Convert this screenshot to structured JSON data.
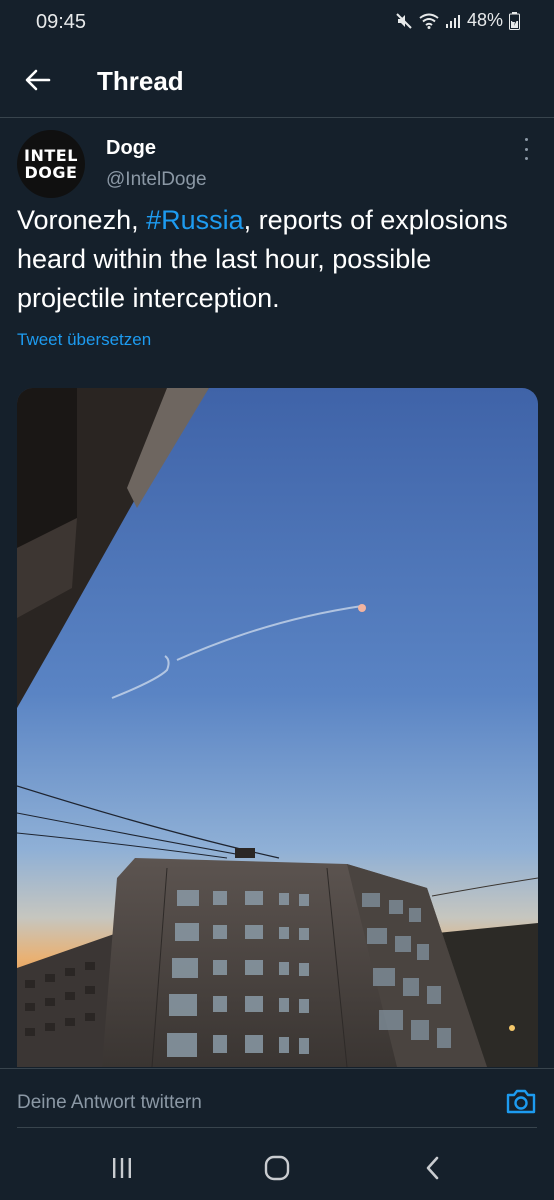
{
  "status_bar": {
    "time": "09:45",
    "battery": "48%",
    "icons": [
      "mute-icon",
      "wifi-icon",
      "signal-icon",
      "battery-icon"
    ]
  },
  "header": {
    "title": "Thread",
    "back_icon": "arrow-left-icon"
  },
  "tweet": {
    "avatar_text_line1": "INTEL",
    "avatar_text_line2": "DOGE",
    "author_name": "Doge",
    "author_handle": "@IntelDoge",
    "text_before": "Voronezh, ",
    "hashtag": "#Russia",
    "text_after": ", reports of explosions heard within the last hour, possible projectile interception.",
    "translate_label": "Tweet übersetzen",
    "more_icon": "more-vertical-icon"
  },
  "reply": {
    "placeholder": "Deine Antwort twittern",
    "camera_icon": "camera-icon"
  },
  "nav": {
    "icons": [
      "recents-icon",
      "home-icon",
      "back-icon"
    ]
  },
  "colors": {
    "background": "#15202b",
    "accent": "#1d9bf0",
    "secondary_text": "#8b98a5",
    "divider": "#38444d"
  }
}
